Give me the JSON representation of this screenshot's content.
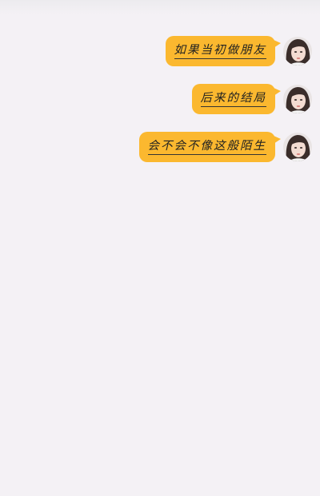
{
  "chat": {
    "messages": [
      {
        "text": "如果当初做朋友",
        "sender": "self",
        "avatar": "girl-portrait-avatar"
      },
      {
        "text": "后来的结局",
        "sender": "self",
        "avatar": "girl-portrait-avatar"
      },
      {
        "text": "会不会不像这般陌生",
        "sender": "self",
        "avatar": "girl-portrait-avatar"
      }
    ]
  },
  "colors": {
    "background": "#f4f1f5",
    "bubble": "#fbb82f",
    "text": "#222222"
  }
}
